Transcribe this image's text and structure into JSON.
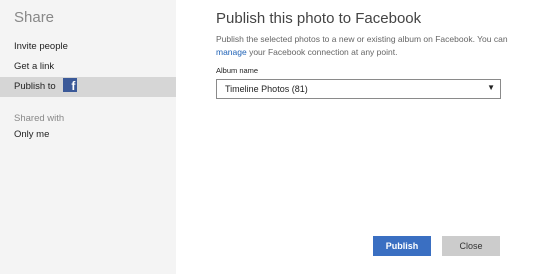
{
  "sidebar": {
    "title": "Share",
    "items": [
      {
        "label": "Invite people"
      },
      {
        "label": "Get a link"
      },
      {
        "label": "Publish to"
      }
    ],
    "publish_icon": "facebook-icon",
    "facebook_glyph": "f",
    "shared_with_label": "Shared with",
    "shared_with_value": "Only me"
  },
  "main": {
    "title": "Publish this photo to Facebook",
    "description_part1": "Publish the selected photos to a new or existing album on Facebook. You can ",
    "description_link": "manage",
    "description_part2": " your Facebook connection at any point.",
    "album_label": "Album name",
    "album_selected": "Timeline Photos (81)",
    "dropdown_arrow": "▼"
  },
  "buttons": {
    "publish": "Publish",
    "close": "Close"
  },
  "colors": {
    "sidebar_bg": "#f4f4f4",
    "active_item_bg": "#d6d6d6",
    "facebook_blue": "#3b5998",
    "primary_button": "#3a6fc2",
    "link": "#1f62b6"
  }
}
